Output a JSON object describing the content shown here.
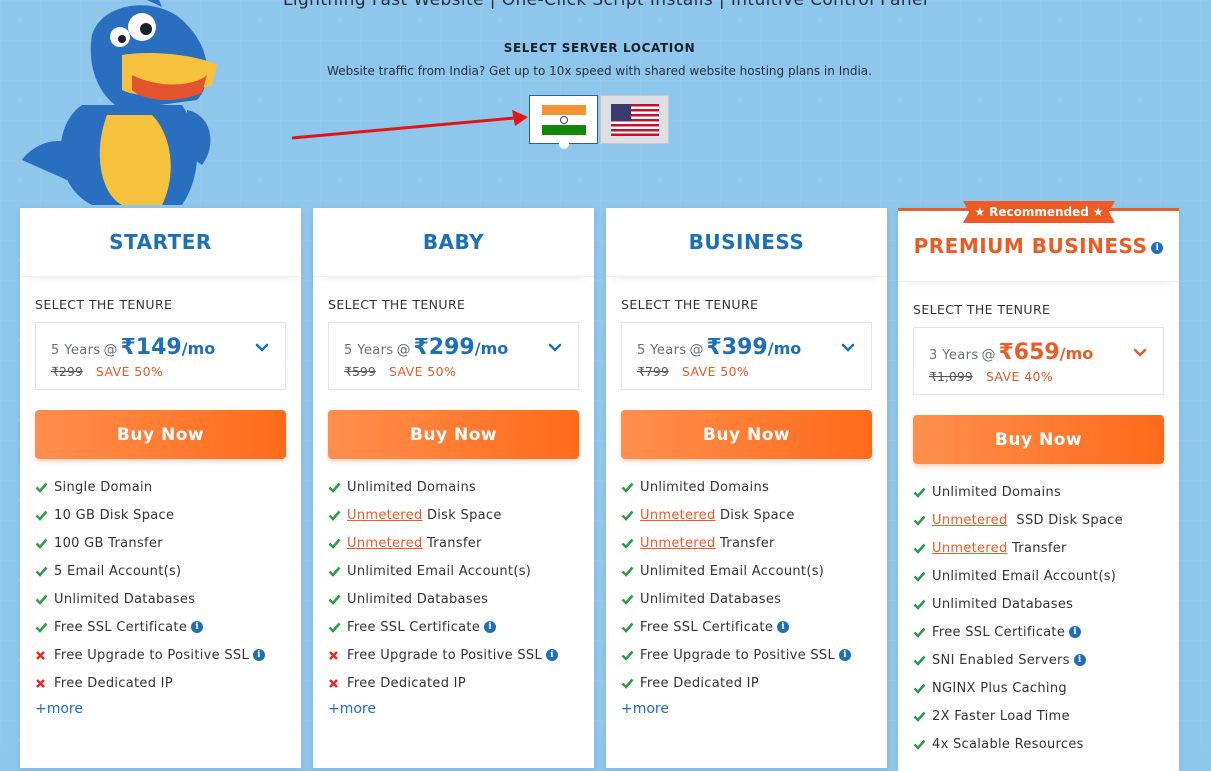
{
  "tagline": "Lightning Fast Website | One-Click Script Installs | Intuitive Control Panel",
  "location": {
    "title": "SELECT SERVER LOCATION",
    "subtitle": "Website traffic from India? Get up to 10x speed with shared website hosting plans in India."
  },
  "plans": [
    {
      "name": "STARTER",
      "tenure_label": "SELECT THE TENURE",
      "years": "5 Years",
      "at": "@",
      "price": "₹149",
      "per": "/mo",
      "old_price": "₹299",
      "save": "SAVE 50%",
      "buy": "Buy Now",
      "features": [
        {
          "text": "Single Domain",
          "ok": true
        },
        {
          "text": "10 GB Disk Space",
          "ok": true
        },
        {
          "text": "100 GB Transfer",
          "ok": true
        },
        {
          "text": "5 Email Account(s)",
          "ok": true
        },
        {
          "text": "Unlimited Databases",
          "ok": true
        },
        {
          "text": "Free SSL Certificate",
          "ok": true,
          "info": true
        },
        {
          "text": "Free Upgrade to Positive SSL",
          "ok": false,
          "info": true
        },
        {
          "text": "Free Dedicated IP",
          "ok": false
        }
      ],
      "more": "+more"
    },
    {
      "name": "BABY",
      "tenure_label": "SELECT THE TENURE",
      "years": "5 Years",
      "at": "@",
      "price": "₹299",
      "per": "/mo",
      "old_price": "₹599",
      "save": "SAVE 50%",
      "buy": "Buy Now",
      "features": [
        {
          "text": "Unlimited Domains",
          "ok": true
        },
        {
          "link": "Unmetered",
          "text": " Disk Space",
          "ok": true
        },
        {
          "link": "Unmetered",
          "text": " Transfer",
          "ok": true
        },
        {
          "text": "Unlimited Email Account(s)",
          "ok": true
        },
        {
          "text": "Unlimited Databases",
          "ok": true
        },
        {
          "text": "Free SSL Certificate",
          "ok": true,
          "info": true
        },
        {
          "text": "Free Upgrade to Positive SSL",
          "ok": false,
          "info": true
        },
        {
          "text": "Free Dedicated IP",
          "ok": false
        }
      ],
      "more": "+more"
    },
    {
      "name": "BUSINESS",
      "tenure_label": "SELECT THE TENURE",
      "years": "5 Years",
      "at": "@",
      "price": "₹399",
      "per": "/mo",
      "old_price": "₹799",
      "save": "SAVE 50%",
      "buy": "Buy Now",
      "features": [
        {
          "text": "Unlimited Domains",
          "ok": true
        },
        {
          "link": "Unmetered",
          "text": " Disk Space",
          "ok": true
        },
        {
          "link": "Unmetered",
          "text": " Transfer",
          "ok": true
        },
        {
          "text": "Unlimited Email Account(s)",
          "ok": true
        },
        {
          "text": "Unlimited Databases",
          "ok": true
        },
        {
          "text": "Free SSL Certificate",
          "ok": true,
          "info": true
        },
        {
          "text": "Free Upgrade to Positive SSL",
          "ok": true,
          "info": true
        },
        {
          "text": "Free Dedicated IP",
          "ok": true
        }
      ],
      "more": "+more"
    },
    {
      "name": "PREMIUM BUSINESS",
      "badge": "Recommended",
      "tenure_label": "SELECT THE TENURE",
      "years": "3 Years",
      "at": "@",
      "price": "₹659",
      "per": "/mo",
      "old_price": "₹1,099",
      "save": "SAVE 40%",
      "buy": "Buy Now",
      "features": [
        {
          "text": "Unlimited Domains",
          "ok": true
        },
        {
          "link": "Unmetered",
          "text": "  SSD Disk Space",
          "ok": true
        },
        {
          "link": "Unmetered",
          "text": " Transfer",
          "ok": true
        },
        {
          "text": "Unlimited Email Account(s)",
          "ok": true
        },
        {
          "text": "Unlimited Databases",
          "ok": true
        },
        {
          "text": "Free SSL Certificate",
          "ok": true,
          "info": true
        },
        {
          "text": "SNI Enabled Servers",
          "ok": true,
          "info": true
        },
        {
          "text": "NGINX Plus Caching",
          "ok": true
        },
        {
          "text": "2X Faster Load Time",
          "ok": true
        },
        {
          "text": "4x Scalable Resources",
          "ok": true
        }
      ]
    }
  ],
  "colors": {
    "brand_blue": "#1d6fb8",
    "accent_orange": "#ee5a24",
    "check_green": "#2e9c4a",
    "cross_red": "#e02b2b"
  }
}
